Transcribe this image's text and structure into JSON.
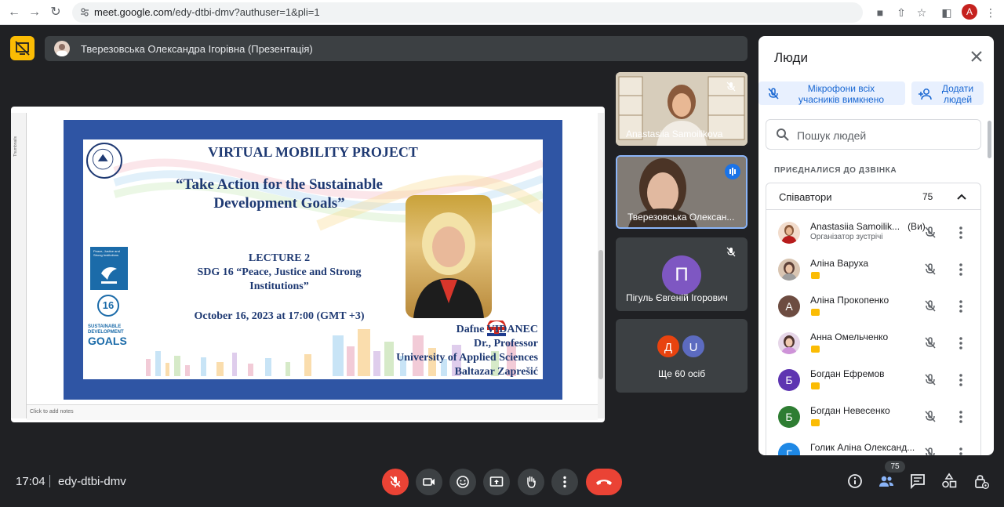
{
  "browser": {
    "url_host": "meet.google.com",
    "url_path": "/edy-dtbi-dmv?authuser=1&pli=1",
    "profile_initial": "A"
  },
  "banner": {
    "presenter_text": "Тверезовська Олександра Ігорівна (Презентація)"
  },
  "slide": {
    "title": "VIRTUAL MOBILITY PROJECT",
    "subtitle_line1": "“Take Action for the Sustainable",
    "subtitle_line2": "Development Goals”",
    "lecture": "LECTURE 2",
    "sdg_line1": "SDG 16 “Peace,  Justice and Strong",
    "sdg_line2": "Institutions”",
    "date": "October 16, 2023 at 17:00 (GMT +3)",
    "speaker_name": "Dafne VIDANEC",
    "speaker_title": "Dr., Professor",
    "speaker_uni": "University of Applied Sciences",
    "speaker_city": "Baltazar Zaprešić",
    "sdg_number": "16",
    "sdg_box_text": "Peace, Justice and Strong Institutions",
    "goals_small": "SUSTAINABLE DEVELOPMENT",
    "goals_big": "GOALS",
    "thumbnails_label": "Thumbnails",
    "notes_placeholder": "Click to add notes"
  },
  "tiles": [
    {
      "name": "Anastasiia Samoilikova"
    },
    {
      "name": "Тверезовська Олексан..."
    },
    {
      "name": "Пігуль Євгеній Ігорович",
      "initial": "П"
    },
    {
      "name": "Ще 60 осіб",
      "initials": [
        "Д",
        "U"
      ]
    }
  ],
  "panel": {
    "title": "Люди",
    "mute_all_line1": "Мікрофони всіх",
    "mute_all_line2": "учасників вимкнено",
    "add_line1": "Додати",
    "add_line2": "людей",
    "search_placeholder": "Пошук людей",
    "section_label": "ПРИЄДНАЛИСЯ ДО ДЗВІНКА",
    "group_label": "Співавтори",
    "group_count": "75",
    "participants": [
      {
        "name": "Anastasiia Samoilik...",
        "you": "(Ви)",
        "sub": "Організатор зустрічі"
      },
      {
        "name": "Аліна Варуха"
      },
      {
        "name": "Аліна Прокопенко",
        "initial": "А"
      },
      {
        "name": "Анна Омельченко"
      },
      {
        "name": "Богдан Ефремов",
        "initial": "Б"
      },
      {
        "name": "Богдан Невесенко",
        "initial": "Б"
      },
      {
        "name": "Голик Аліна Олександ...",
        "initial": "Г"
      }
    ]
  },
  "bottom": {
    "time": "17:04",
    "meeting_code": "edy-dtbi-dmv",
    "people_count": "75"
  },
  "colors": {
    "background": "#202124",
    "accent": "#1a73e8",
    "danger": "#ea4335",
    "warning": "#fbbc04"
  }
}
